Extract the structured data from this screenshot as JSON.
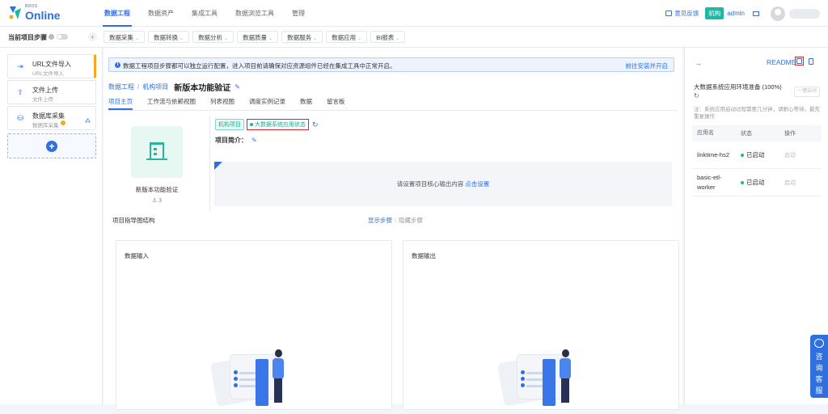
{
  "brand": {
    "small": "BDOS",
    "big": "Online"
  },
  "nav": {
    "items": [
      "数据工程",
      "数据资产",
      "集成工具",
      "数据浏览工具",
      "管理"
    ]
  },
  "header": {
    "feedback": "意见反馈",
    "org_badge": "机构",
    "admin": "admin"
  },
  "toolbar": {
    "current_step_label": "当前项目步骤",
    "collapse": "‹",
    "menus": [
      "数据采集",
      "数据转换",
      "数据分析",
      "数据质量",
      "数据服务",
      "数据应用",
      "BI报表"
    ],
    "menu_caret": "⌄"
  },
  "sidebar": {
    "steps": [
      {
        "title": "URL文件导入",
        "subtitle": "URL文件导入",
        "icon": "⇥"
      },
      {
        "title": "文件上传",
        "subtitle": "文件上传",
        "icon": "⇧"
      },
      {
        "title": "数据库采集",
        "subtitle": "数据库采集",
        "icon": "⛁"
      }
    ],
    "add": "+"
  },
  "notice": {
    "icon": "i",
    "text": "数据工程项目步骤都可以独立运行配置，进入项目前请确保对应资源组件已经在集成工具中正常开启。",
    "link": "前往安装并开启"
  },
  "breadcrumb": {
    "root": "数据工程",
    "sep": "/",
    "parent": "机构项目",
    "title": "新版本功能验证",
    "edit": "✎"
  },
  "tabs": [
    "项目主页",
    "工作流与依赖视图",
    "列表视图",
    "调度实例记录",
    "数据",
    "留言板"
  ],
  "project": {
    "name": "新版本功能验证",
    "users": "♙ 3",
    "tag_org": "机构项目",
    "tag_status": "大数据系统应用状态",
    "refresh": "↻",
    "intro_label": "项目简介：",
    "intro_edit": "✎",
    "output_text": "请设置项目核心输出内容",
    "output_link": "点击设置"
  },
  "guide": {
    "title": "项目指导图结构",
    "show": "显示步骤",
    "sep": "|",
    "hide": "隐藏步骤",
    "input_title": "数据输入",
    "output_title": "数据输出"
  },
  "right_panel": {
    "arrow": "→",
    "readme": "README",
    "env_title": "大数据系统应用环境准备 (100%)",
    "spin": "↻",
    "onekey": "一键启动",
    "note": "注：系统应用启动过程需要几分钟，请耐心等待，最先重复操作",
    "columns": [
      "应用名",
      "状态",
      "操作"
    ],
    "rows": [
      {
        "name": "linktime-hs2",
        "status": "已启动",
        "action": "启动"
      },
      {
        "name": "basic-etl-worker",
        "status": "已启动",
        "action": "启动"
      }
    ]
  },
  "consult": "咨询客服",
  "colors": {
    "primary": "#2f6fe0",
    "success": "#1fb88a",
    "highlight": "#e0242b",
    "warning": "#f5a623"
  }
}
